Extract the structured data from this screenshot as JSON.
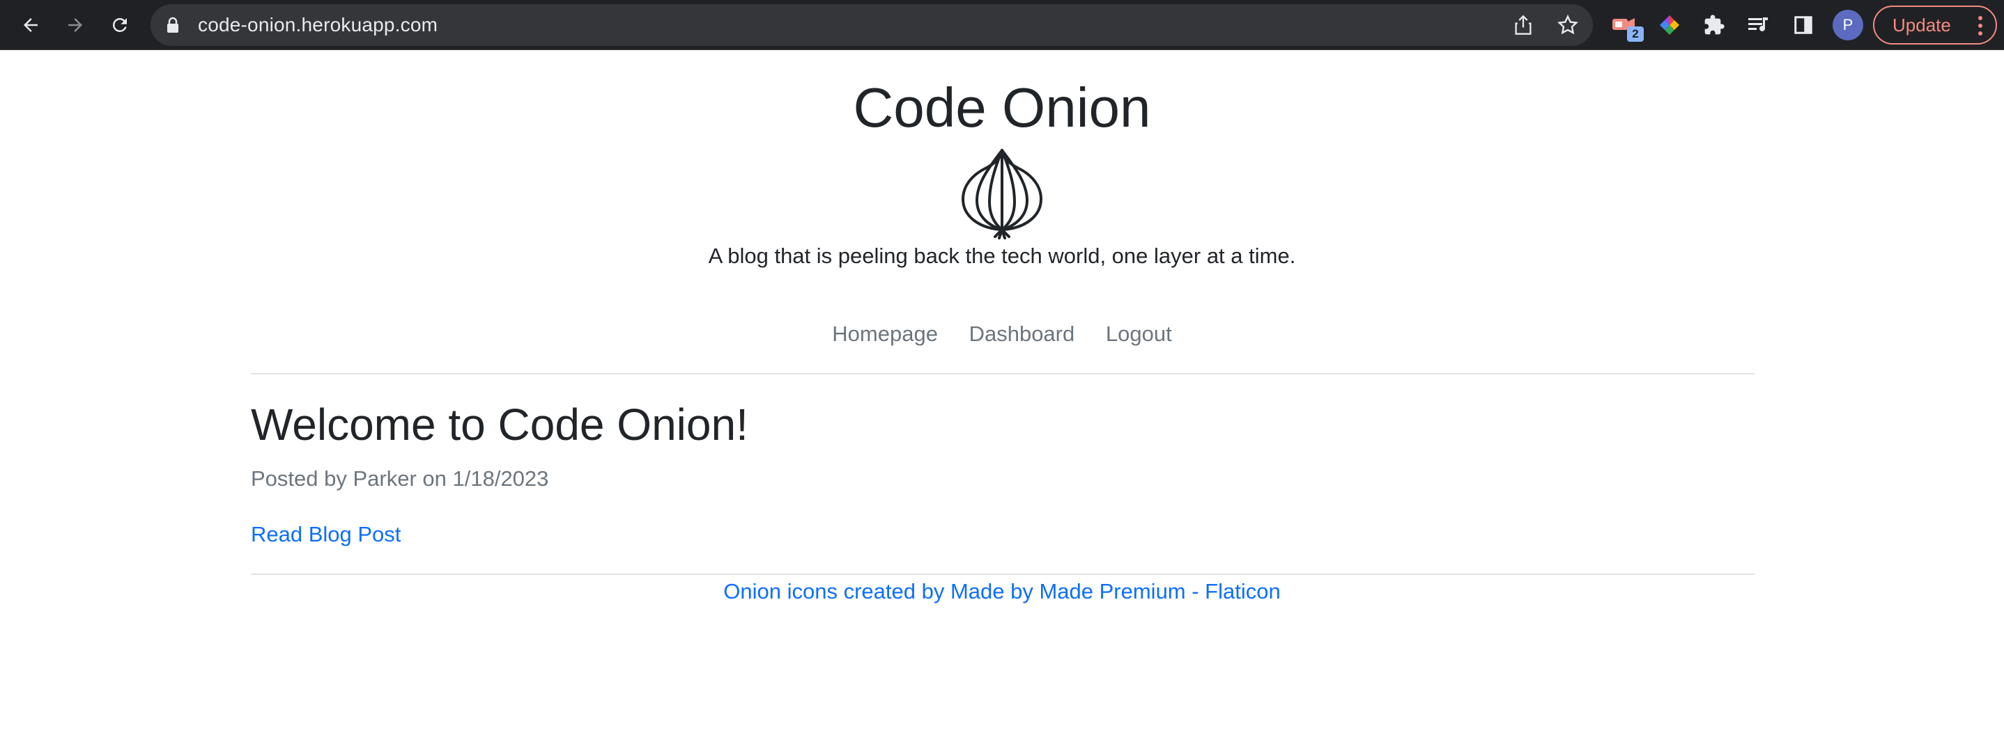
{
  "browser": {
    "url": "code-onion.herokuapp.com",
    "extension_badge": "2",
    "profile_initial": "P",
    "update_label": "Update",
    "colors": {
      "chrome_bg": "#202124",
      "omnibox_bg": "#35363a",
      "update_accent": "#f28b82"
    }
  },
  "site": {
    "title": "Code Onion",
    "logo_icon": "onion-icon",
    "tagline": "A blog that is peeling back the tech world, one layer at a time."
  },
  "nav": {
    "items": [
      {
        "label": "Homepage"
      },
      {
        "label": "Dashboard"
      },
      {
        "label": "Logout"
      }
    ]
  },
  "post": {
    "title": "Welcome to Code Onion!",
    "meta": "Posted by Parker on 1/18/2023",
    "link_label": "Read Blog Post"
  },
  "footer": {
    "credit": "Onion icons created by Made by Made Premium - Flaticon"
  },
  "colors": {
    "link": "#0d6efd",
    "muted": "#6c757d",
    "text": "#212529",
    "rule": "#dee2e6"
  }
}
